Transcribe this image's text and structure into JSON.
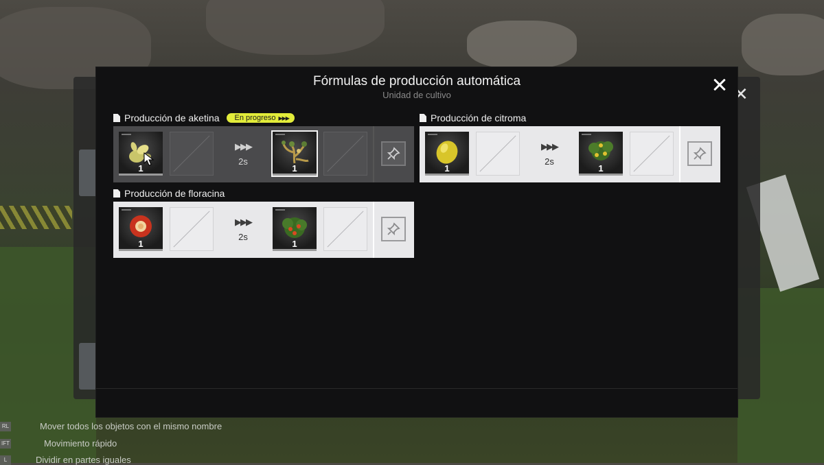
{
  "dialog": {
    "title": "Fórmulas de producción automática",
    "subtitle": "Unidad de cultivo"
  },
  "formulas": [
    {
      "name": "Producción de aketina",
      "status_badge": "En progreso",
      "state": "active",
      "input": {
        "item": "aketina-seed",
        "count": "1"
      },
      "time": "2s",
      "output": {
        "item": "aketina-plant",
        "count": "1"
      }
    },
    {
      "name": "Producción de citroma",
      "state": "idle",
      "input": {
        "item": "citroma-seed",
        "count": "1"
      },
      "time": "2s",
      "output": {
        "item": "citroma-plant",
        "count": "1"
      }
    },
    {
      "name": "Producción de floracina",
      "state": "idle",
      "input": {
        "item": "floracina-seed",
        "count": "1"
      },
      "time": "2s",
      "output": {
        "item": "floracina-plant",
        "count": "1"
      }
    }
  ],
  "background_hints": [
    "Mover todos los objetos con el mismo nombre",
    "Movimiento rápido",
    "Dividir en partes iguales"
  ],
  "background_keys": [
    "RL",
    "IFT",
    "L"
  ],
  "colors": {
    "badge": "#e2ec3a",
    "dialog_bg": "#111112",
    "formula_bg_idle": "#e8e8ea",
    "formula_bg_active": "#4a4a4c"
  }
}
